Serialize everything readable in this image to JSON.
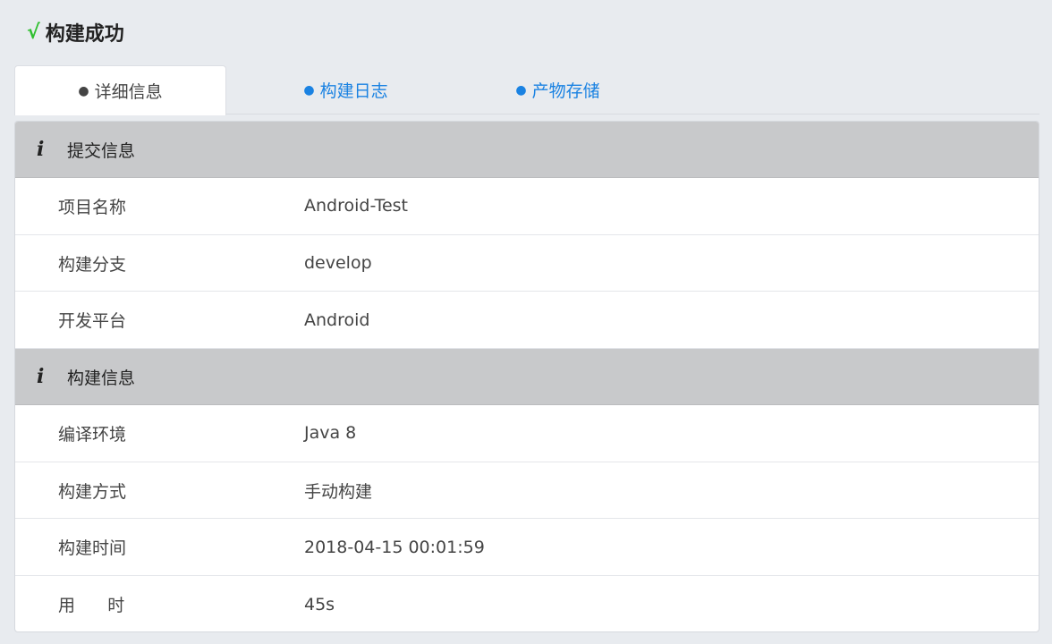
{
  "header": {
    "status_icon": "√",
    "title": "构建成功"
  },
  "tabs": [
    {
      "label": "详细信息",
      "active": true
    },
    {
      "label": "构建日志",
      "active": false
    },
    {
      "label": "产物存储",
      "active": false
    }
  ],
  "sections": [
    {
      "title": "提交信息",
      "rows": [
        {
          "key": "项目名称",
          "value": "Android-Test"
        },
        {
          "key": "构建分支",
          "value": "develop"
        },
        {
          "key": "开发平台",
          "value": "Android"
        }
      ]
    },
    {
      "title": "构建信息",
      "rows": [
        {
          "key": "编译环境",
          "value": "Java 8"
        },
        {
          "key": "构建方式",
          "value": "手动构建"
        },
        {
          "key": "构建时间",
          "value": "2018-04-15 00:01:59"
        },
        {
          "key": "用      时",
          "value": "45s"
        }
      ]
    }
  ],
  "colors": {
    "success": "#2fbf2f",
    "link": "#1a82e2",
    "section_header": "#c8c9cb"
  }
}
